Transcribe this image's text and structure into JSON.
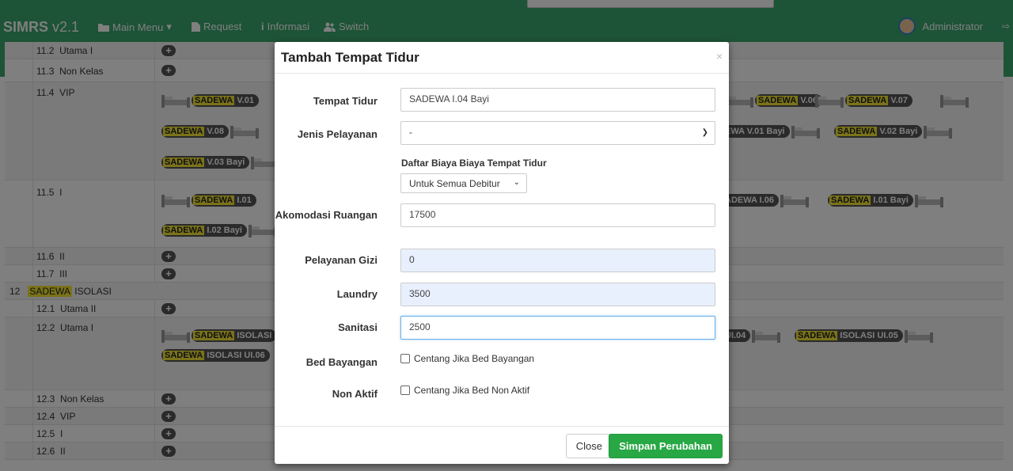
{
  "navbar": {
    "brand": "SIMRS",
    "version": "v2.1",
    "menu": [
      {
        "label": "Main Menu"
      },
      {
        "label": "Request"
      },
      {
        "label": "Informasi"
      },
      {
        "label": "Switch"
      }
    ],
    "user": "Administrator"
  },
  "table": {
    "rows": [
      {
        "no": "11.2",
        "name": "Utama I"
      },
      {
        "no": "11.3",
        "name": "Non Kelas"
      },
      {
        "no": "11.4",
        "name": "VIP"
      },
      {
        "no": "11.5",
        "name": "I"
      },
      {
        "no": "11.6",
        "name": "II"
      },
      {
        "no": "11.7",
        "name": "III"
      },
      {
        "no": "12.1",
        "name": "Utama II"
      },
      {
        "no": "12.2",
        "name": "Utama I"
      },
      {
        "no": "12.3",
        "name": "Non Kelas"
      },
      {
        "no": "12.4",
        "name": "VIP"
      },
      {
        "no": "12.5",
        "name": "I"
      },
      {
        "no": "12.6",
        "name": "II"
      }
    ],
    "group12": {
      "no": "12",
      "highlight": "SADEWA",
      "rest": "ISOLASI"
    },
    "beds": {
      "vip_row1": [
        {
          "hl": "SADEWA",
          "rest": "V.01"
        },
        {
          "hl": "SADEWA",
          "rest": "V.06"
        },
        {
          "hl": "SADEWA",
          "rest": "V.07"
        }
      ],
      "vip_row2": [
        {
          "hl": "SADEWA",
          "rest": "V.08"
        },
        {
          "hl": "",
          "rest": "EWA V.01 Bayi"
        },
        {
          "hl": "SADEWA",
          "rest": "V.02 Bayi"
        }
      ],
      "vip_row3": [
        {
          "hl": "SADEWA",
          "rest": "V.03 Bayi"
        }
      ],
      "i_row1": [
        {
          "hl": "SADEWA",
          "rest": "I.01"
        },
        {
          "hl": "",
          "rest": "ADEWA I.06"
        },
        {
          "hl": "SADEWA",
          "rest": "I.01 Bayi"
        }
      ],
      "i_row2": [
        {
          "hl": "SADEWA",
          "rest": "I.02 Bayi"
        }
      ],
      "iso_row1": [
        {
          "hl": "SADEWA",
          "rest": "ISOLASI"
        },
        {
          "hl": "",
          "rest": "UI.04"
        },
        {
          "hl": "SADEWA",
          "rest": "ISOLASI UI.05"
        }
      ],
      "iso_row2": [
        {
          "hl": "SADEWA",
          "rest": "ISOLASI UI.06"
        }
      ]
    }
  },
  "modal": {
    "title": "Tambah Tempat Tidur",
    "close_x": "×",
    "fields": {
      "tempat_tidur": {
        "label": "Tempat Tidur",
        "value": "SADEWA I.04 Bayi"
      },
      "jenis_pelayanan": {
        "label": "Jenis Pelayanan",
        "value": "-"
      },
      "daftar_biaya": {
        "label": "Daftar Biaya Biaya Tempat Tidur",
        "value": "Untuk Semua Debitur"
      },
      "akomodasi": {
        "label": "Akomodasi Ruangan",
        "value": "17500"
      },
      "gizi": {
        "label": "Pelayanan Gizi",
        "value": "0"
      },
      "laundry": {
        "label": "Laundry",
        "value": "3500"
      },
      "sanitasi": {
        "label": "Sanitasi",
        "value": "2500"
      },
      "bed_bayangan": {
        "label": "Bed Bayangan",
        "text": "Centang Jika Bed Bayangan"
      },
      "non_aktif": {
        "label": "Non Aktif",
        "text": "Centang Jika Bed Non Aktif"
      }
    },
    "buttons": {
      "close": "Close",
      "save": "Simpan Perubahan"
    }
  },
  "colors": {
    "navbar": "#3aa76d",
    "save_button": "#28a745",
    "highlight": "#f4e634"
  }
}
